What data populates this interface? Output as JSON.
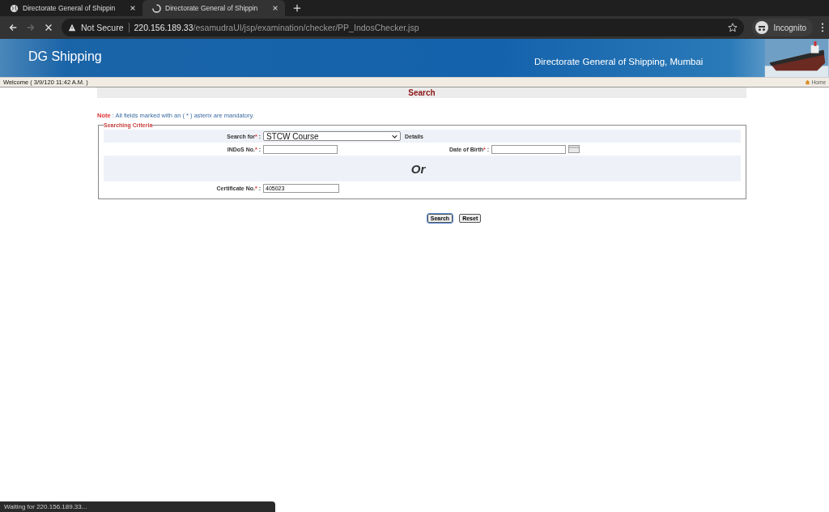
{
  "browser": {
    "tabs": [
      {
        "title": "Directorate General of Shippin",
        "selected": false,
        "loading": false
      },
      {
        "title": "Directorate General of Shippin",
        "selected": true,
        "loading": true
      }
    ],
    "security": "Not Secure",
    "url_host": "220.156.189.33",
    "url_path": "/esamudraUI/jsp/examination/checker/PP_IndosChecker.jsp",
    "profile": "Incognito"
  },
  "header": {
    "logo": "DG Shipping",
    "title": "Directorate General of Shipping, Mumbai"
  },
  "welcome": "Welcome ( 3/9/120 11:42 A.M. )",
  "home_link": "Home",
  "page_title": "Search",
  "note": {
    "label": "Note",
    "text": ": All fields marked with an ( * ) asterix are mandatory."
  },
  "fieldset": {
    "legend": "Searching Criteria",
    "search_for": {
      "label": "Search for",
      "mark": "*",
      "sep": ":",
      "value": "STCW Course",
      "details": "Details"
    },
    "indos": {
      "label": "INDoS No.",
      "mark": "*",
      "sep": ":"
    },
    "dob": {
      "label": "Date of Birth",
      "mark": "*",
      "sep": ":"
    },
    "divider": "Or",
    "certificate": {
      "label": "Certificate No.",
      "mark": "*",
      "sep": ":",
      "value": "405023"
    }
  },
  "buttons": [
    "Search",
    "Reset"
  ],
  "status_bar": "Waiting for 220.156.189.33..."
}
